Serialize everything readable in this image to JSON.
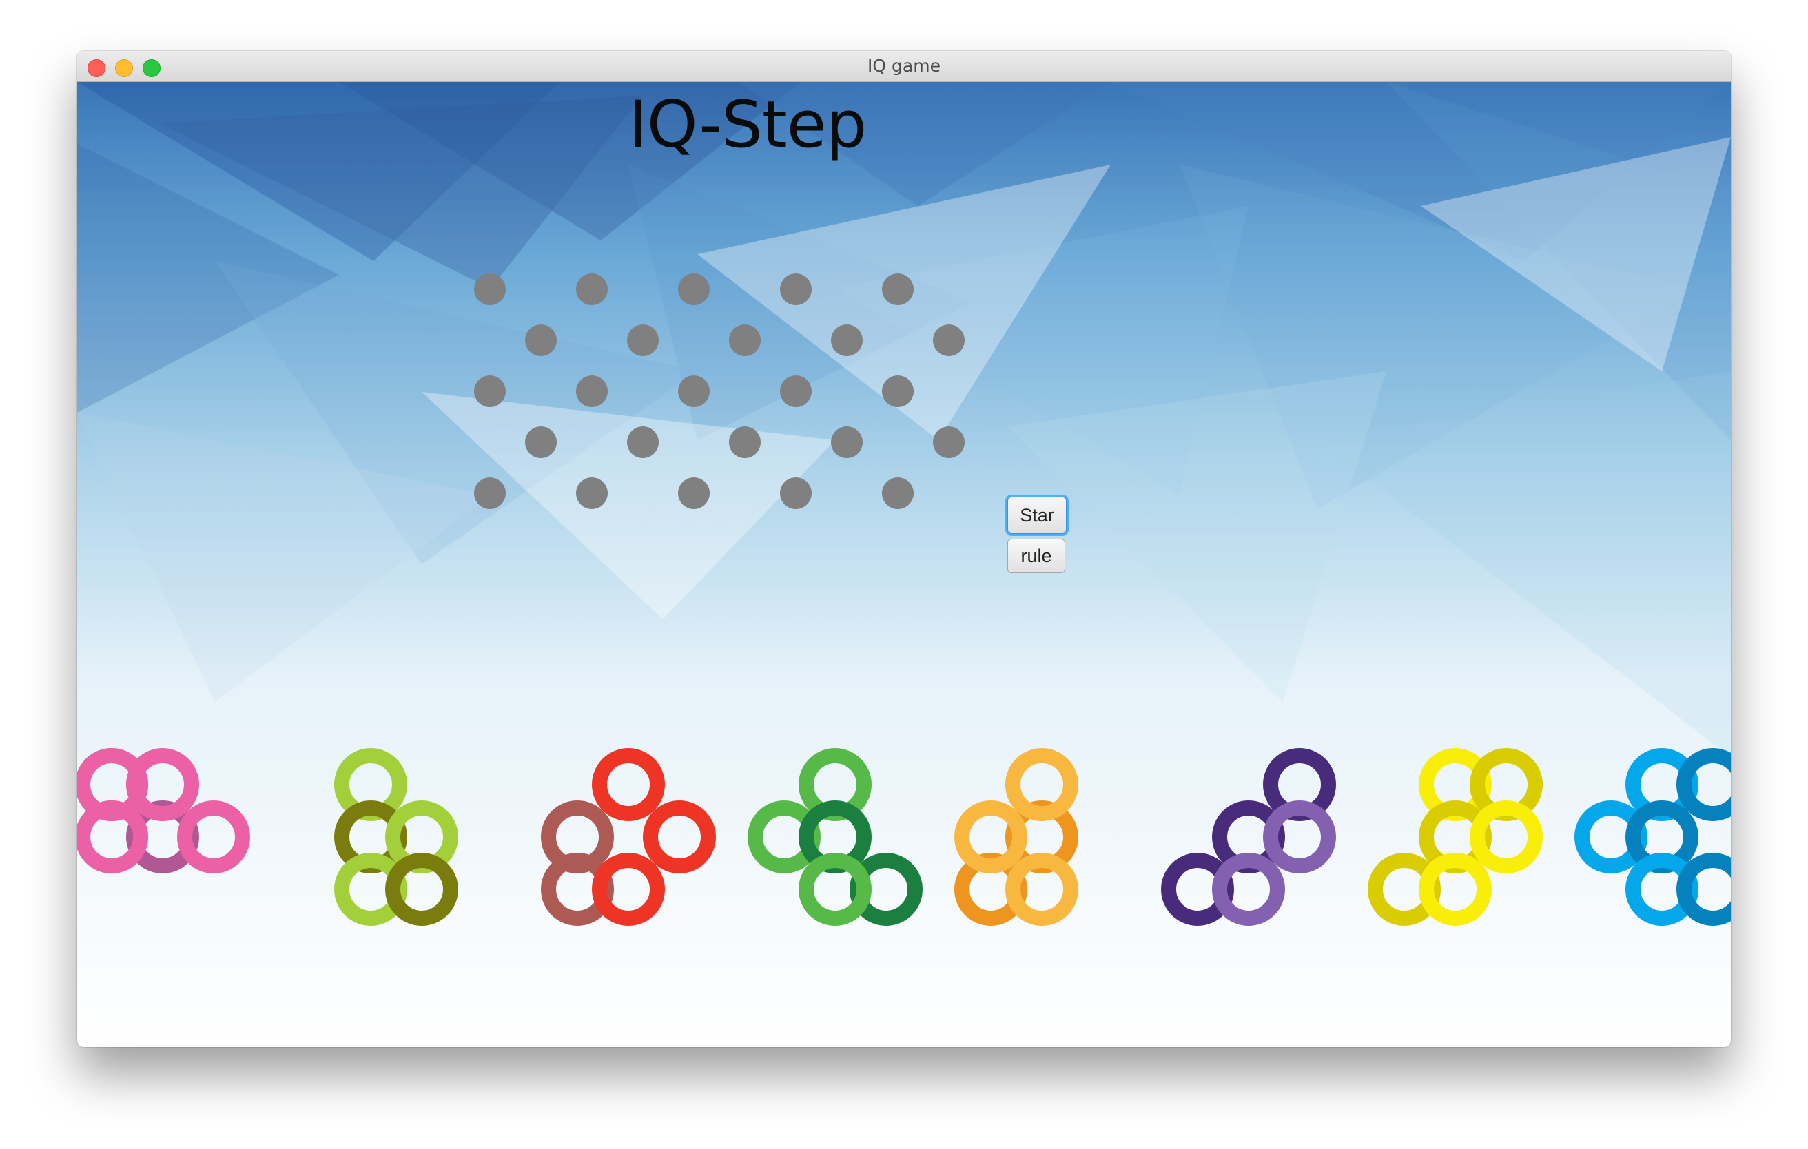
{
  "window": {
    "title": "IQ game"
  },
  "header": {
    "title": "IQ-Step"
  },
  "board": {
    "rows": 5,
    "pegs_per_row": 5,
    "peg_color": "#808080"
  },
  "buttons": {
    "start_label": "Star",
    "rule_label": "rule"
  },
  "pieces": [
    {
      "name": "piece-a",
      "colors": [
        "#b05794",
        "#ec61a5"
      ]
    },
    {
      "name": "piece-b",
      "colors": [
        "#a3cf3b",
        "#7a7c0d"
      ]
    },
    {
      "name": "piece-c",
      "colors": [
        "#ee3424",
        "#ad5a55"
      ]
    },
    {
      "name": "piece-d",
      "colors": [
        "#57b947",
        "#1a7f3f"
      ]
    },
    {
      "name": "piece-e",
      "colors": [
        "#f8b73f",
        "#ee951f"
      ]
    },
    {
      "name": "piece-f",
      "colors": [
        "#482b7a",
        "#8460b0"
      ]
    },
    {
      "name": "piece-g",
      "colors": [
        "#f8ee07",
        "#d9cc00"
      ]
    },
    {
      "name": "piece-h",
      "colors": [
        "#04a7e9",
        "#0582be"
      ]
    }
  ]
}
